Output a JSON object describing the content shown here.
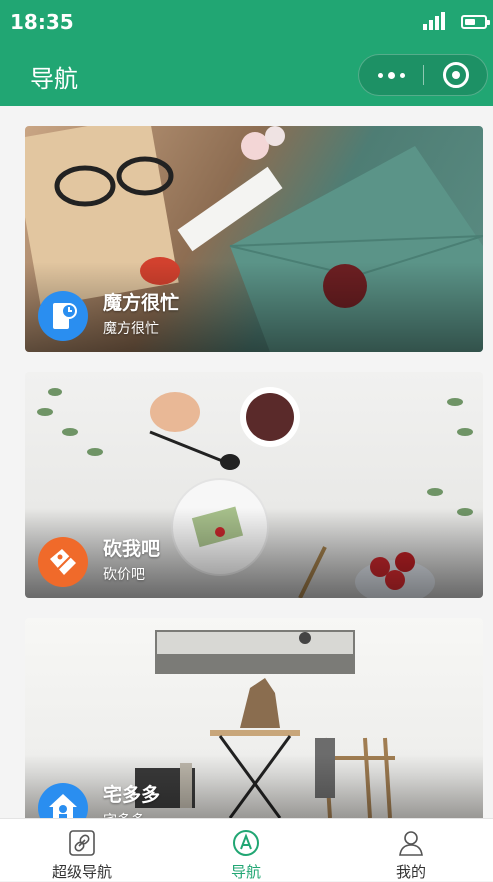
{
  "status": {
    "time": "18:35"
  },
  "nav": {
    "title": "导航"
  },
  "cards": [
    {
      "title": "魔方很忙",
      "subtitle": "魔方很忙",
      "icon": "phone-clock-icon",
      "icon_color": "#2a8ef0"
    },
    {
      "title": "砍我吧",
      "subtitle": "砍价吧",
      "icon": "price-tag-icon",
      "icon_color": "#f06a2a"
    },
    {
      "title": "宅多多",
      "subtitle": "宅多多",
      "icon": "house-icon",
      "icon_color": "#2a8ef0"
    }
  ],
  "tabbar": {
    "items": [
      {
        "label": "超级导航",
        "icon": "link-icon",
        "active": false
      },
      {
        "label": "导航",
        "icon": "compass-a-icon",
        "active": true
      },
      {
        "label": "我的",
        "icon": "user-icon",
        "active": false
      }
    ]
  },
  "colors": {
    "brand": "#21a673",
    "tab_inactive": "#333333"
  }
}
